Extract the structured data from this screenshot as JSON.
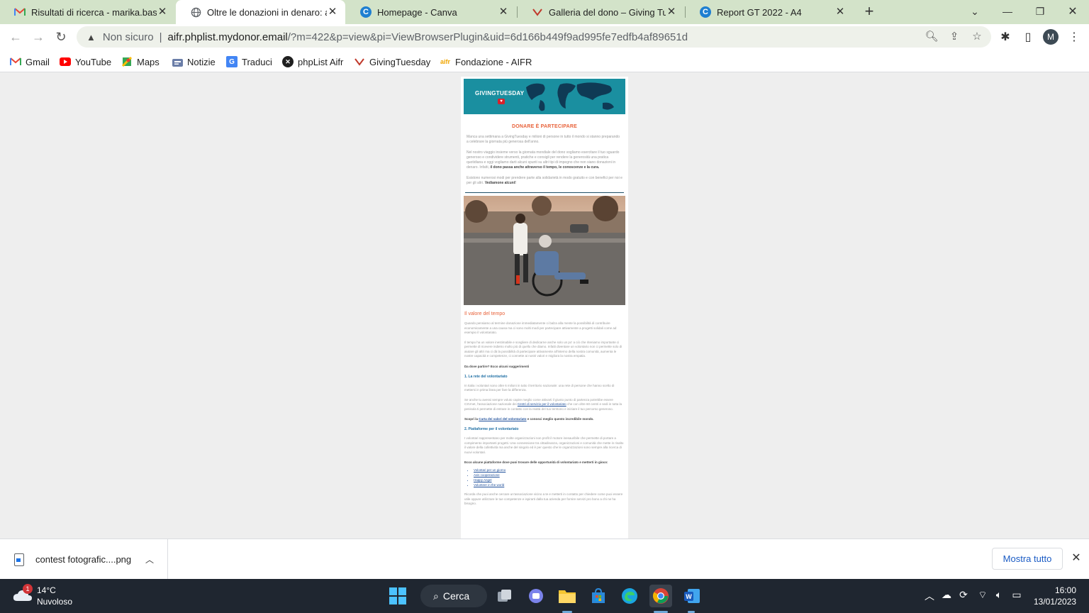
{
  "tabs": [
    {
      "title": "Risultati di ricerca - marika.bastia",
      "icon": "gmail-icon",
      "active": false
    },
    {
      "title": "Oltre le donazioni in denaro: altri",
      "icon": "globe-icon",
      "active": true
    },
    {
      "title": "Homepage - Canva",
      "icon": "canva-icon",
      "active": false
    },
    {
      "title": "Galleria del dono – Giving Tuesd",
      "icon": "givingtuesday-icon",
      "active": false
    },
    {
      "title": "Report GT 2022 - A4",
      "icon": "canva-icon",
      "active": false
    }
  ],
  "toolbar": {
    "security_label": "Non sicuro",
    "url_host": "aifr.phplist.mydonor.email",
    "url_path": "/?m=422&p=view&pi=ViewBrowserPlugin&uid=6d166b449f9ad995fe7edfb4af89651d",
    "profile_initial": "M"
  },
  "bookmarks": [
    {
      "label": "Gmail",
      "icon": "gmail-icon"
    },
    {
      "label": "YouTube",
      "icon": "youtube-icon"
    },
    {
      "label": "Maps",
      "icon": "maps-icon"
    },
    {
      "label": "Notizie",
      "icon": "news-icon"
    },
    {
      "label": "Traduci",
      "icon": "translate-icon"
    },
    {
      "label": "phpList Aifr",
      "icon": "phplist-icon"
    },
    {
      "label": "GivingTuesday",
      "icon": "givingtuesday-icon"
    },
    {
      "label": "Fondazione - AIFR",
      "icon": "aifr-icon"
    }
  ],
  "email": {
    "logo_text": "GIVINGTUESDAY",
    "section_title": "DONARE È PARTECIPARE",
    "intro_1": "Manca una settimana a GivingTuesday e milioni di persone in tutto il mondo si stanno preparando a celebrare la giornata più generosa dell'anno.",
    "intro_2": "Nel nostro viaggio insieme verso la giornata mondiale del dono vogliamo esercitare il tuo sguardo generoso e condividere strumenti, pratiche e consigli per rendere la generosità una pratica quotidiana e oggi vogliamo darti alcuni spunti su altri tipi di impegno che non siano donazioni in denaro. Infatti, ",
    "intro_2_bold": "il dono passa anche attraverso il tempo, le conoscenze e la cura.",
    "intro_3": "Esistono numerosi modi per prendere parte alla solidarietà in modo gratuito e con benefici per noi e per gli altri. ",
    "intro_3_bold": "Vediamone alcuni!",
    "h_time": "Il valore del tempo",
    "time_p1": "Quando pensiamo al termine donazione immediatamente ci balza alla mente la possibilità di contribuire economicamente a una causa ma ci sono molti modi per partecipare attivamente a progetti solidali come ad esempio il volontariato.",
    "time_p2": "Il tempo ha un valore inestimabile e scegliere di dedicarne anche solo un po' a ciò che riteniamo importante ci permette di ricevere indietro molto più di quello che diamo. Infatti diventare un volontario non ci permette solo di aiutare gli altri ma ci dà la possibilità di partecipare attivamente all'interno della nostra comunità, aumenta le nostre capacità e competenze, ci connette ai nostri valori e migliora la nostra empatia.",
    "start_q": "Da dove partire? Ecco alcuni suggerimenti",
    "h_net": "1. La rete del volontariato",
    "net_p1": "In Italia i volontari sono oltre 6 milioni in tutto il territorio nazionale: una rete di persone che hanno scelto di mettersi in prima linea per fare la differenza.",
    "net_p2_a": "Se anche tu avessi sempre voluto capire meglio come attivarti il giusto punto di partenza potrebbe essere CSVnet, l'associazione nazionale dei ",
    "net_p2_link": "Centri di servizio per il volontariato",
    "net_p2_b": " che con oltre 60 centri e sedi in tutta la penisola ti permette di entrare in contatto con la realtà del tuo territorio e iniziare il tuo percorso generoso.",
    "discover_a": "Scopri la ",
    "discover_link": "Carta dei valori del volontariato",
    "discover_b": " e conosci meglio questo incredibile mondo.",
    "h_plat": "2. Piattaforme per il volontariato",
    "plat_p1": "I volontari rappresentano per molte organizzazioni non profit il motore inesauribile che permette di portare a compimento importanti progetti. Una connessione tra cittadinanza, organizzazioni e comunità che mette in risalto il valore della collettività ma anche del singolo ed è per questo che le organizzazioni sono sempre alla ricerca di nuovi volontari.",
    "plat_bold": "Ecco alcune piattaforme dove puoi trovare delle opportunità di volontariato e metterti in gioco:",
    "platforms": [
      "Volontari per un giorno",
      "Avis cooperazione",
      "Happy Angel",
      "Volunteer in the world"
    ],
    "closing": "Ricorda che puoi anche cercare un'associazione vicino a te e metterti in contatto per chiedere come puoi essere utile oppure utilizzare le tue competenze e ispirarti dalla tua azienda per fornire servizi pro bono a chi ne ha bisogno."
  },
  "download": {
    "file_name": "contest fotografic....png",
    "show_all": "Mostra tutto"
  },
  "taskbar": {
    "weather_temp": "14°C",
    "weather_desc": "Nuvoloso",
    "weather_badge": "1",
    "search_label": "Cerca",
    "time": "16:00",
    "date": "13/01/2023"
  },
  "colors": {
    "tab_strip": "#d3e3c9",
    "accent_orange": "#e8623a",
    "hero_teal": "#1a8fa0",
    "link_blue": "#1a5bc4"
  }
}
